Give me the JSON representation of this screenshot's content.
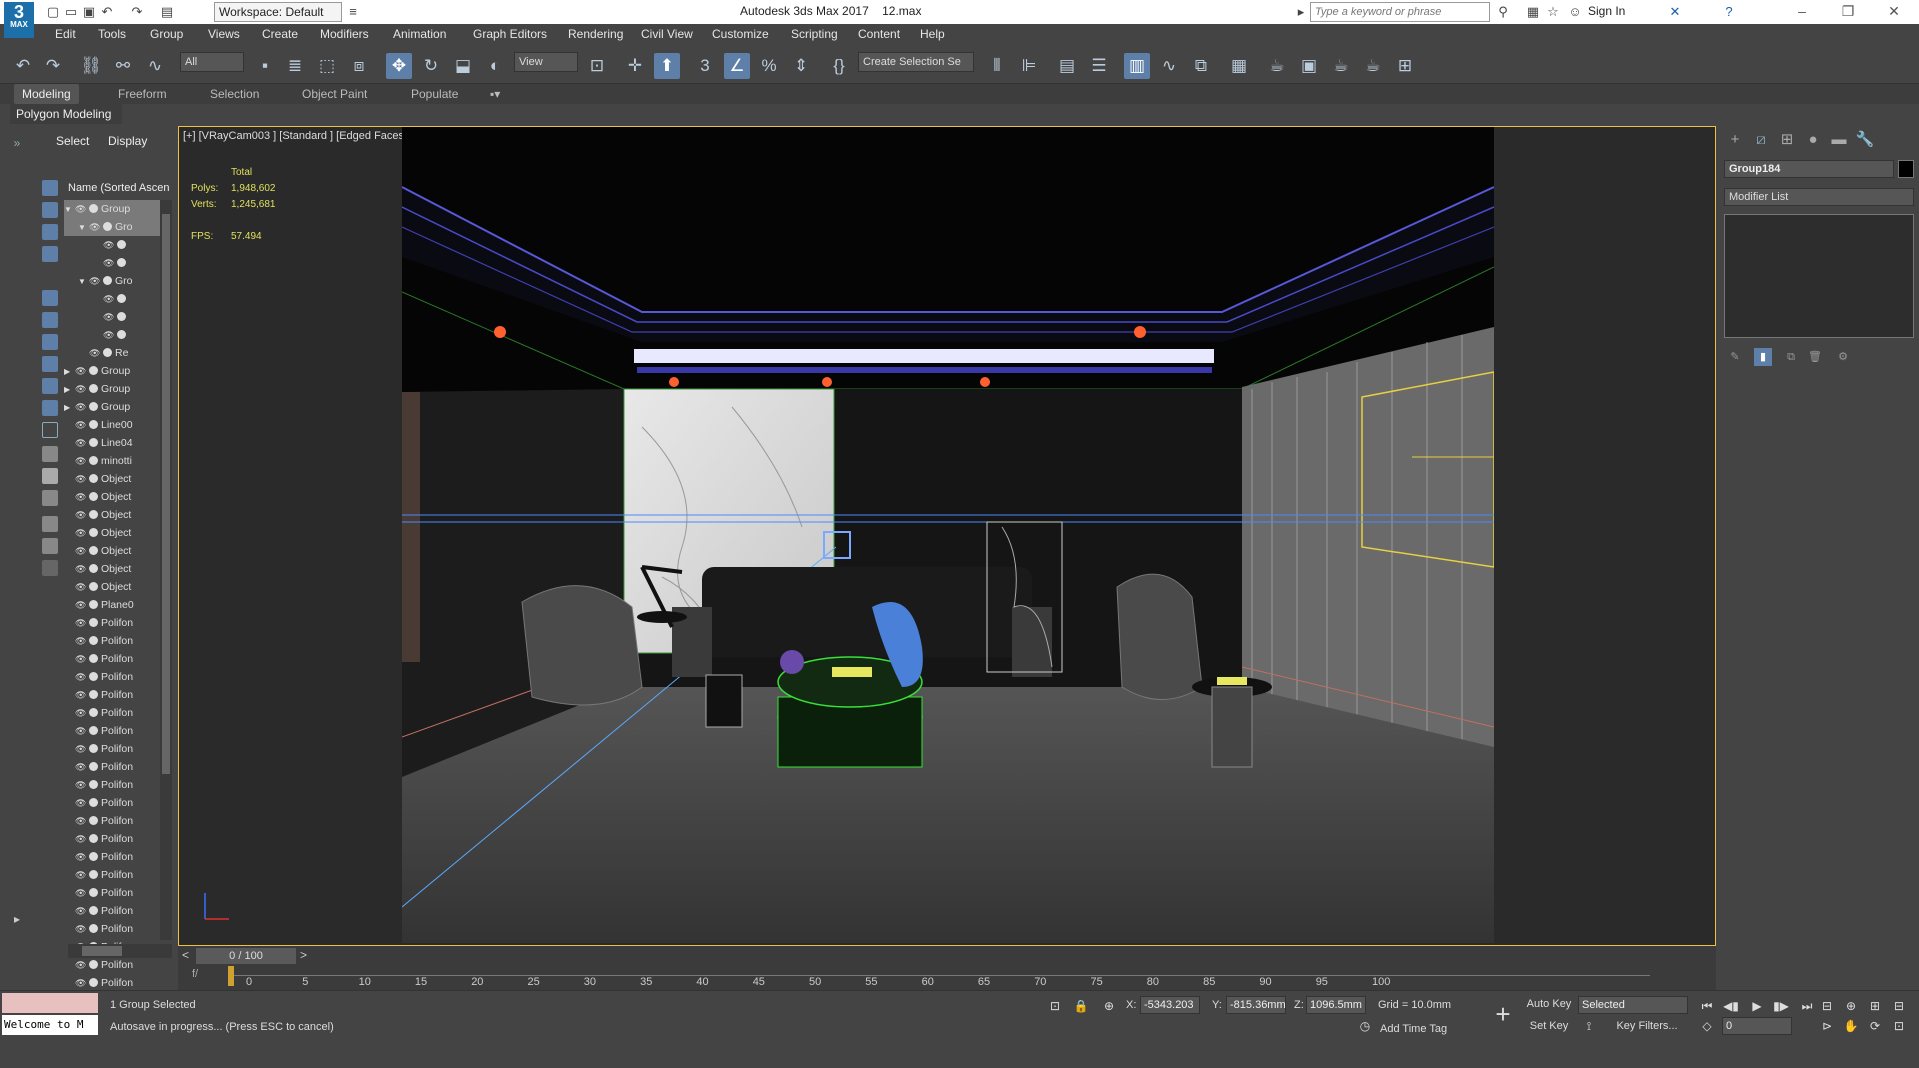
{
  "titlebar": {
    "workspace": "Workspace: Default",
    "app_title": "Autodesk 3ds Max 2017",
    "file_name": "12.max",
    "search_placeholder": "Type a keyword or phrase",
    "sign_in": "Sign In",
    "logo": "3",
    "logo_sub": "MAX"
  },
  "menu": [
    "Edit",
    "Tools",
    "Group",
    "Views",
    "Create",
    "Modifiers",
    "Animation",
    "Graph Editors",
    "Rendering",
    "Civil View",
    "Customize",
    "Scripting",
    "Content",
    "Help"
  ],
  "toolbar": {
    "filter": "All",
    "ref_coord": "View",
    "selection_set": "Create Selection Se"
  },
  "ribbon": {
    "tabs": [
      "Modeling",
      "Freeform",
      "Selection",
      "Object Paint",
      "Populate"
    ],
    "panel": "Polygon Modeling"
  },
  "explorer": {
    "tabs": [
      "Select",
      "Display"
    ],
    "header": "Name (Sorted Ascending)",
    "rows": [
      {
        "label": "Group",
        "indent": 0,
        "arrow": "▼",
        "selected": true
      },
      {
        "label": "Gro",
        "indent": 1,
        "arrow": "▼",
        "selected": true
      },
      {
        "label": "",
        "indent": 2,
        "arrow": "",
        "selected": false
      },
      {
        "label": "",
        "indent": 2,
        "arrow": "",
        "selected": false
      },
      {
        "label": "Gro",
        "indent": 1,
        "arrow": "▼",
        "selected": false
      },
      {
        "label": "",
        "indent": 2,
        "arrow": "",
        "selected": false
      },
      {
        "label": "",
        "indent": 2,
        "arrow": "",
        "selected": false
      },
      {
        "label": "",
        "indent": 2,
        "arrow": "",
        "selected": false
      },
      {
        "label": "Re",
        "indent": 1,
        "arrow": "",
        "selected": false
      },
      {
        "label": "Group",
        "indent": 0,
        "arrow": "▶",
        "selected": false
      },
      {
        "label": "Group",
        "indent": 0,
        "arrow": "▶",
        "selected": false
      },
      {
        "label": "Group",
        "indent": 0,
        "arrow": "▶",
        "selected": false
      },
      {
        "label": "Line00",
        "indent": 0,
        "arrow": "",
        "selected": false
      },
      {
        "label": "Line04",
        "indent": 0,
        "arrow": "",
        "selected": false
      },
      {
        "label": "minotti",
        "indent": 0,
        "arrow": "",
        "selected": false
      },
      {
        "label": "Object",
        "indent": 0,
        "arrow": "",
        "selected": false
      },
      {
        "label": "Object",
        "indent": 0,
        "arrow": "",
        "selected": false
      },
      {
        "label": "Object",
        "indent": 0,
        "arrow": "",
        "selected": false
      },
      {
        "label": "Object",
        "indent": 0,
        "arrow": "",
        "selected": false
      },
      {
        "label": "Object",
        "indent": 0,
        "arrow": "",
        "selected": false
      },
      {
        "label": "Object",
        "indent": 0,
        "arrow": "",
        "selected": false
      },
      {
        "label": "Object",
        "indent": 0,
        "arrow": "",
        "selected": false
      },
      {
        "label": "Plane0",
        "indent": 0,
        "arrow": "",
        "selected": false
      },
      {
        "label": "Polifon",
        "indent": 0,
        "arrow": "",
        "selected": false
      },
      {
        "label": "Polifon",
        "indent": 0,
        "arrow": "",
        "selected": false
      },
      {
        "label": "Polifon",
        "indent": 0,
        "arrow": "",
        "selected": false
      },
      {
        "label": "Polifon",
        "indent": 0,
        "arrow": "",
        "selected": false
      },
      {
        "label": "Polifon",
        "indent": 0,
        "arrow": "",
        "selected": false
      },
      {
        "label": "Polifon",
        "indent": 0,
        "arrow": "",
        "selected": false
      },
      {
        "label": "Polifon",
        "indent": 0,
        "arrow": "",
        "selected": false
      },
      {
        "label": "Polifon",
        "indent": 0,
        "arrow": "",
        "selected": false
      },
      {
        "label": "Polifon",
        "indent": 0,
        "arrow": "",
        "selected": false
      },
      {
        "label": "Polifon",
        "indent": 0,
        "arrow": "",
        "selected": false
      },
      {
        "label": "Polifon",
        "indent": 0,
        "arrow": "",
        "selected": false
      },
      {
        "label": "Polifon",
        "indent": 0,
        "arrow": "",
        "selected": false
      },
      {
        "label": "Polifon",
        "indent": 0,
        "arrow": "",
        "selected": false
      },
      {
        "label": "Polifon",
        "indent": 0,
        "arrow": "",
        "selected": false
      },
      {
        "label": "Polifon",
        "indent": 0,
        "arrow": "",
        "selected": false
      },
      {
        "label": "Polifon",
        "indent": 0,
        "arrow": "",
        "selected": false
      },
      {
        "label": "Polifon",
        "indent": 0,
        "arrow": "",
        "selected": false
      },
      {
        "label": "Polifon",
        "indent": 0,
        "arrow": "",
        "selected": false
      },
      {
        "label": "Polifon",
        "indent": 0,
        "arrow": "",
        "selected": false
      },
      {
        "label": "Polifon",
        "indent": 0,
        "arrow": "",
        "selected": false
      },
      {
        "label": "Polifon",
        "indent": 0,
        "arrow": "",
        "selected": false
      }
    ]
  },
  "viewport": {
    "label": "[+] [VRayCam003 ] [Standard ] [Edged Faces ]",
    "stats_total": "Total",
    "polys_label": "Polys:",
    "polys_value": "1,948,602",
    "verts_label": "Verts:",
    "verts_value": "1,245,681",
    "fps_label": "FPS:",
    "fps_value": "57.494"
  },
  "command_panel": {
    "object_name": "Group184",
    "modifier_list": "Modifier List"
  },
  "timeline": {
    "frame": "0 / 100",
    "ticks": [
      "0",
      "5",
      "10",
      "15",
      "20",
      "25",
      "30",
      "35",
      "40",
      "45",
      "50",
      "55",
      "60",
      "65",
      "70",
      "75",
      "80",
      "85",
      "90",
      "95",
      "100"
    ]
  },
  "status": {
    "listener_text": "Welcome to M",
    "selection": "1 Group Selected",
    "prompt": "Autosave in progress... (Press ESC to cancel)",
    "x_label": "X:",
    "x_value": "-5343.203",
    "y_label": "Y:",
    "y_value": "-815.36mm",
    "z_label": "Z:",
    "z_value": "1096.5mm",
    "grid": "Grid = 10.0mm",
    "add_time_tag": "Add Time Tag",
    "auto_key": "Auto Key",
    "set_key": "Set Key",
    "selected_dd": "Selected",
    "key_filters": "Key Filters...",
    "current_frame": "0"
  },
  "colors": {
    "accent": "#5e7fa8",
    "viewport_border": "#f0c040",
    "stats_text": "#e0e060"
  }
}
